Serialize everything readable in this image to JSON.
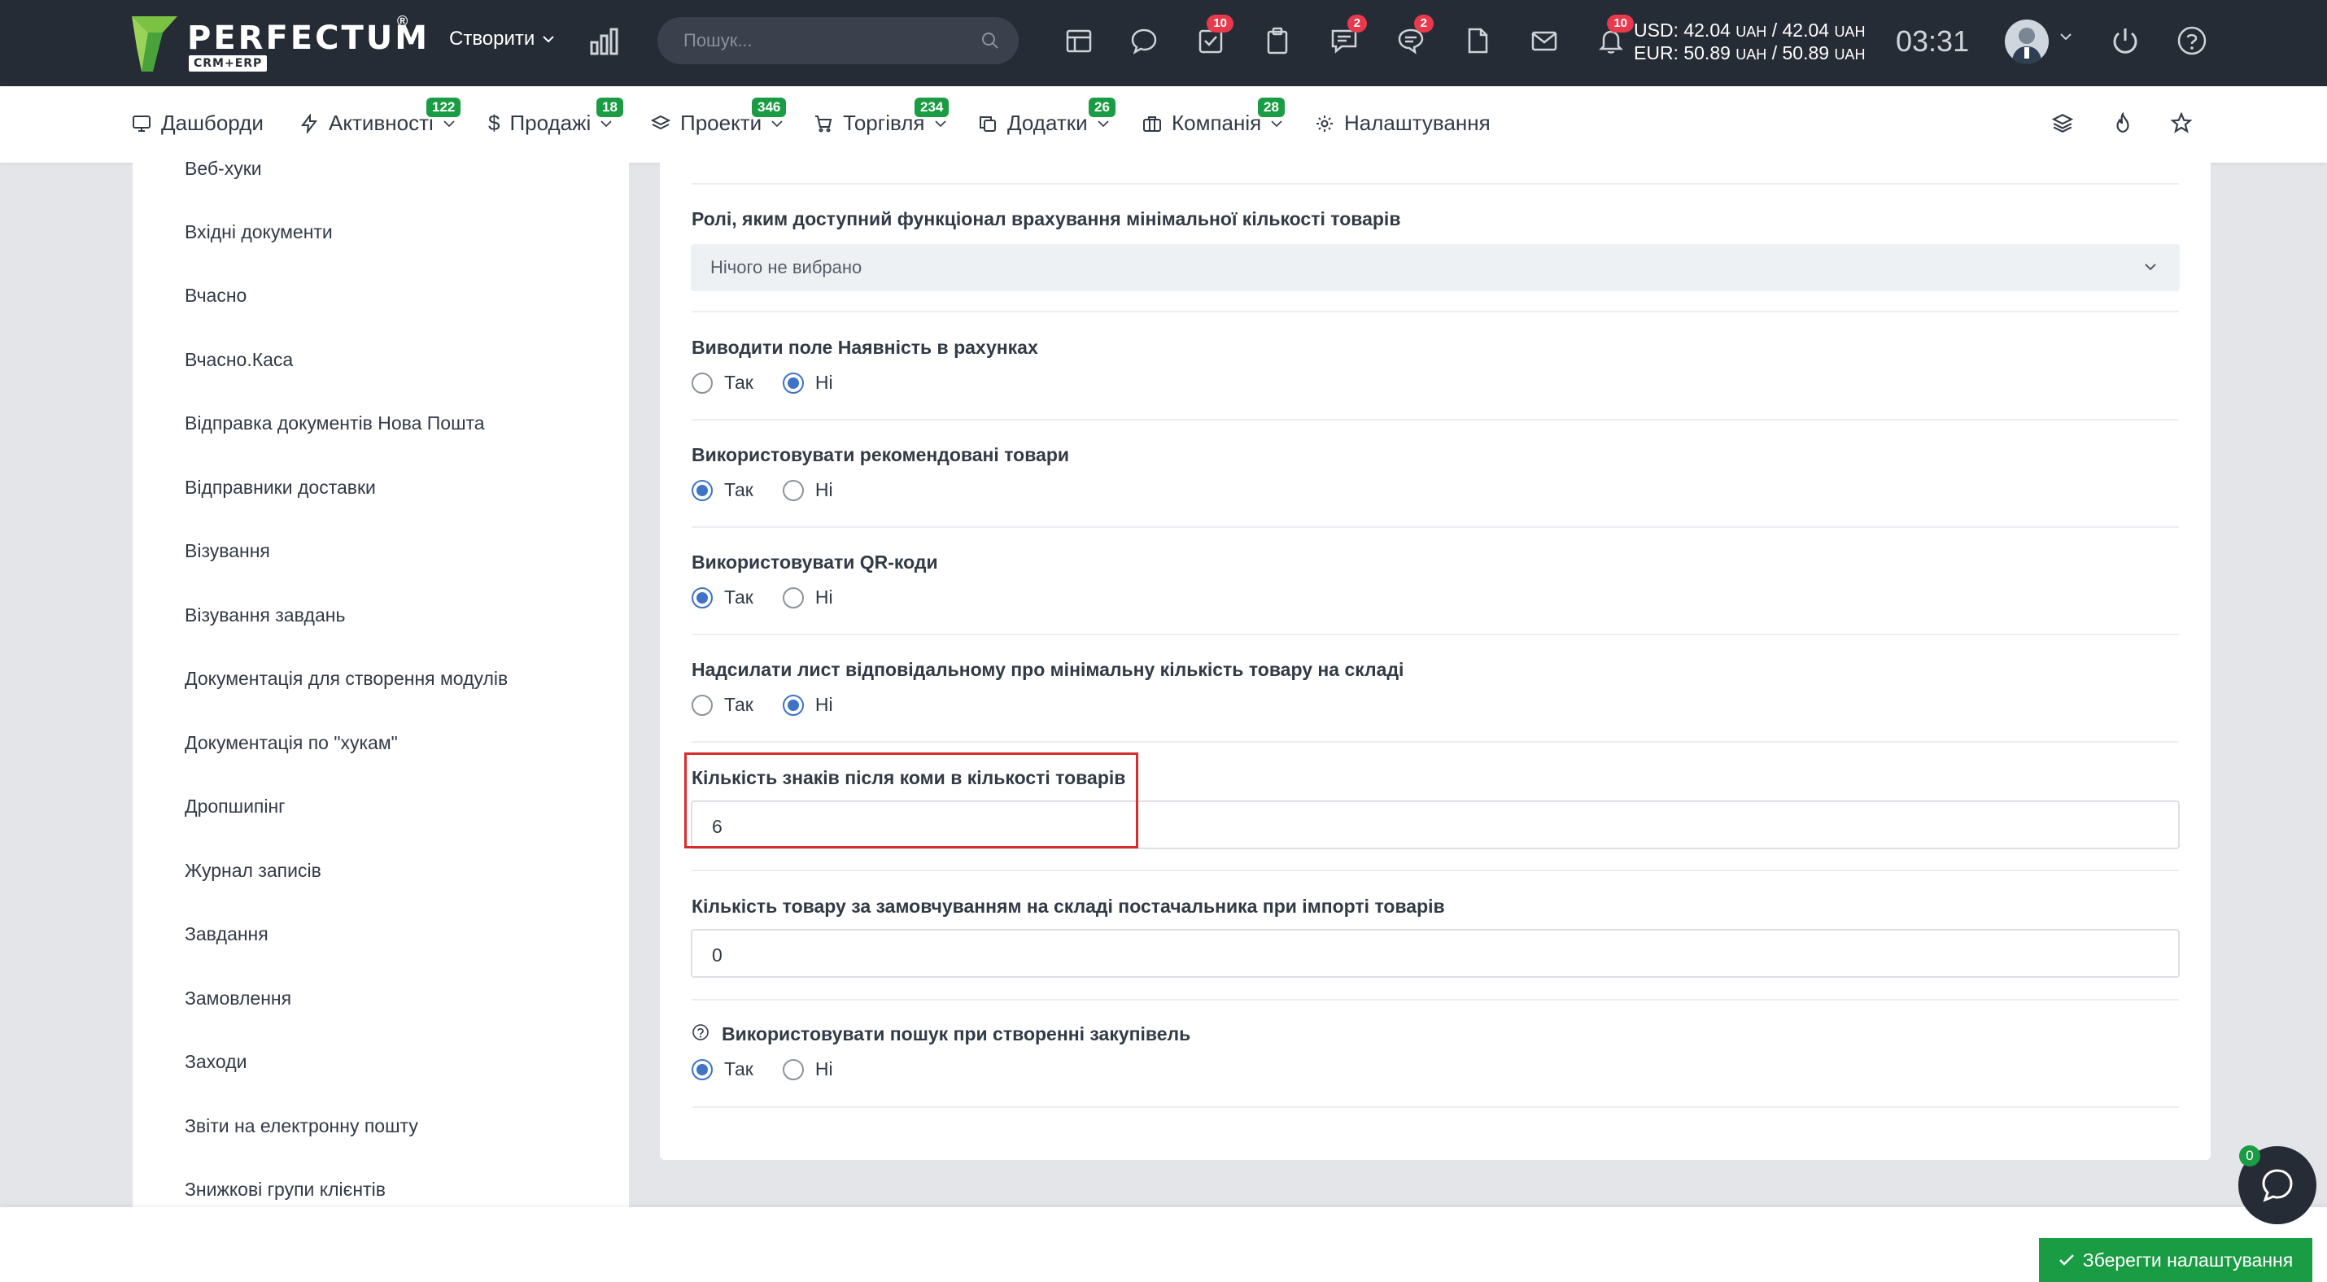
{
  "header": {
    "logo_text": "PERFECTUM",
    "logo_reg": "®",
    "logo_sub": "CRM+ERP",
    "create_label": "Створити",
    "search_placeholder": "Пошук...",
    "badges": {
      "tasks": "10",
      "messages": "2",
      "comments": "2",
      "notifications": "10"
    },
    "currency": {
      "usd_prefix": "USD: 42.04",
      "usd_sep": " / 42.04",
      "unit": "UAH",
      "eur_prefix": "EUR: 50.89",
      "eur_sep": " / 50.89"
    },
    "time": "03:31"
  },
  "nav": {
    "items": [
      {
        "label": "Дашборди",
        "icon": "monitor-icon"
      },
      {
        "label": "Активності",
        "badge": "122",
        "icon": "bolt-icon"
      },
      {
        "label": "Продажі",
        "badge": "18",
        "icon": "dollar-icon"
      },
      {
        "label": "Проекти",
        "badge": "346",
        "icon": "layers-icon"
      },
      {
        "label": "Торгівля",
        "badge": "234",
        "icon": "cart-icon"
      },
      {
        "label": "Додатки",
        "badge": "26",
        "icon": "copy-icon"
      },
      {
        "label": "Компанія",
        "badge": "28",
        "icon": "briefcase-icon"
      },
      {
        "label": "Налаштування",
        "icon": "gear-icon"
      }
    ]
  },
  "sidebar": {
    "items": [
      "Веб-хуки",
      "Вхідні документи",
      "Вчасно",
      "Вчасно.Каса",
      "Відправка документів Нова Пошта",
      "Відправники доставки",
      "Візування",
      "Візування завдань",
      "Документація для створення модулів",
      "Документація по \"хукам\"",
      "Дропшипінг",
      "Журнал записів",
      "Завдання",
      "Замовлення",
      "Заходи",
      "Звіти на електронну пошту",
      "Знижкові групи клієнтів"
    ]
  },
  "settings": {
    "roles_label": "Ролі, яким доступний функціонал врахування мінімальної кількості товарів",
    "roles_value": "Нічого не вибрано",
    "yes": "Так",
    "no": "Ні",
    "availability_label": "Виводити поле Наявність в рахунках",
    "availability_value": "Ні",
    "recommended_label": "Використовувати рекомендовані товари",
    "recommended_value": "Так",
    "qr_label": "Використовувати QR-коди",
    "qr_value": "Так",
    "min_letter_label": "Надсилати лист відповідальному про мінімальну кількість товару на складі",
    "min_letter_value": "Ні",
    "decimals_label": "Кількість знаків після коми в кількості товарів",
    "decimals_value": "6",
    "default_qty_label": "Кількість товару за замовчуванням на складі постачальника при імпорті товарів",
    "default_qty_value": "0",
    "search_purchase_label": "Використовувати пошук при створенні закупівель",
    "search_purchase_value": "Так"
  },
  "footer": {
    "save_label": "Зберегти налаштування",
    "chat_badge": "0"
  }
}
